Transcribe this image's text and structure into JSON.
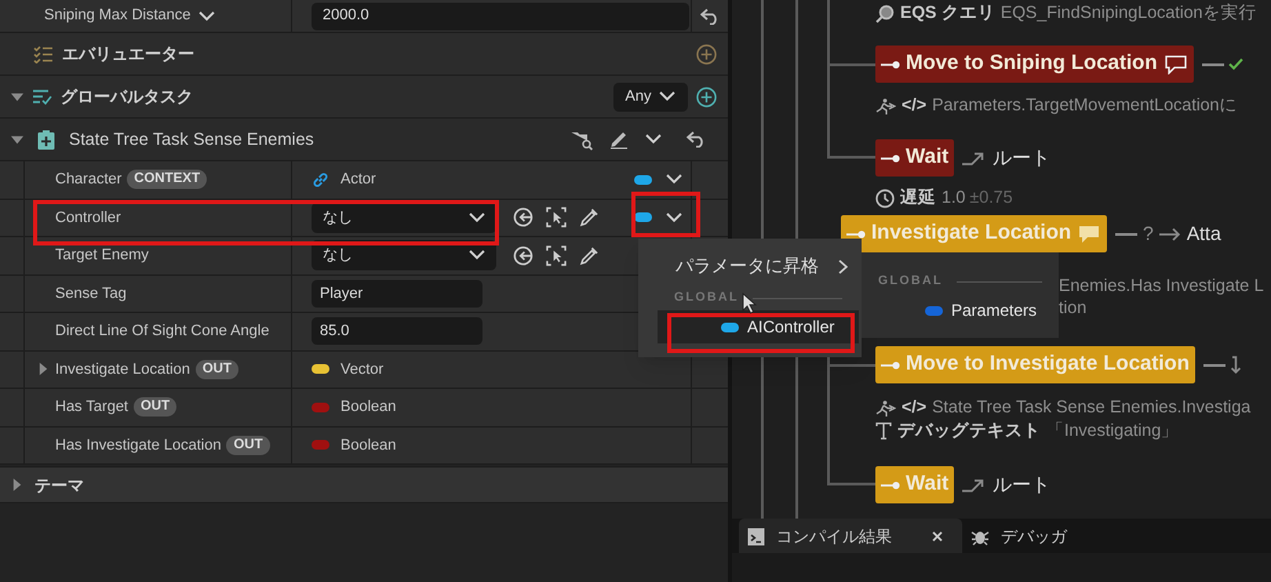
{
  "details": {
    "top_row": {
      "label": "Sniping Max Distance",
      "value": "2000.0"
    },
    "evaluators": {
      "title": "エバリュエーター"
    },
    "global_tasks": {
      "title": "グローバルタスク",
      "expanded": true,
      "mode": "Any"
    },
    "task": {
      "title": "State Tree Task Sense Enemies",
      "expanded": true,
      "properties": [
        {
          "label": "Character",
          "tag": "CONTEXT",
          "kind": "bound",
          "value": "Actor",
          "color": "#1ea7e8"
        },
        {
          "label": "Controller",
          "kind": "object",
          "value": "なし",
          "color": "#1ea7e8"
        },
        {
          "label": "Target Enemy",
          "kind": "object",
          "value": "なし"
        },
        {
          "label": "Sense Tag",
          "kind": "text",
          "value": "Player"
        },
        {
          "label": "Direct Line Of Sight Cone Angle",
          "kind": "text",
          "value": "85.0"
        },
        {
          "label": "Investigate Location",
          "tag": "OUT",
          "kind": "output",
          "value": "Vector",
          "color": "#e8c234",
          "expanded": false
        },
        {
          "label": "Has Target",
          "tag": "OUT",
          "kind": "output",
          "value": "Boolean",
          "color": "#a01010"
        },
        {
          "label": "Has Investigate Location",
          "tag": "OUT",
          "kind": "output",
          "value": "Boolean",
          "color": "#a01010"
        }
      ]
    },
    "theme": {
      "title": "テーマ",
      "expanded": false
    }
  },
  "bind_menu": {
    "items": [
      {
        "kind": "submenu",
        "label": "パラメータに昇格"
      },
      {
        "kind": "header",
        "label": "GLOBAL"
      },
      {
        "kind": "option",
        "label": "AIController",
        "color": "#1ea7e8",
        "selected": true
      }
    ]
  },
  "submenu": {
    "items": [
      {
        "kind": "header",
        "label": "GLOBAL"
      },
      {
        "kind": "option",
        "label": "Parameters",
        "color": "#1565d8"
      }
    ]
  },
  "graph": {
    "items": [
      {
        "kind": "query",
        "bold": "EQS クエリ",
        "text": "EQS_FindSnipingLocationを実行"
      },
      {
        "kind": "task",
        "label": "Move to Sniping Location",
        "color": "#7a1a14",
        "comment": true,
        "transition": {
          "kind": "done"
        }
      },
      {
        "kind": "binding",
        "bold": "</>",
        "text": "Parameters.TargetMovementLocationに"
      },
      {
        "kind": "task",
        "label": "Wait",
        "color": "#7a1a14",
        "transition": {
          "kind": "goto",
          "target": "ルート"
        }
      },
      {
        "kind": "delay",
        "bold": "遅延",
        "text": "1.0",
        "extra": "±0.75"
      },
      {
        "kind": "state",
        "label": "Investigate Location",
        "color": "#d49b17",
        "comment": true,
        "transition": {
          "kind": "condition",
          "mark": "?",
          "target": "Atta"
        }
      },
      {
        "kind": "plain",
        "text": "Enemies.Has Investigate L"
      },
      {
        "kind": "plain",
        "text": "tion"
      },
      {
        "kind": "task",
        "label": "Move to Investigate Location",
        "color": "#d49b17",
        "transition": {
          "kind": "down"
        }
      },
      {
        "kind": "binding",
        "bold": "</>",
        "text": "State Tree Task Sense Enemies.Investiga"
      },
      {
        "kind": "debug",
        "bold": "デバッグテキスト",
        "text": "「Investigating」"
      },
      {
        "kind": "task",
        "label": "Wait",
        "color": "#d49b17",
        "transition": {
          "kind": "goto",
          "target": "ルート"
        }
      }
    ]
  },
  "bottom_tabs": [
    {
      "label": "コンパイル結果",
      "selected": true,
      "closable": true
    },
    {
      "label": "デバッガ",
      "selected": false,
      "closable": false
    }
  ]
}
